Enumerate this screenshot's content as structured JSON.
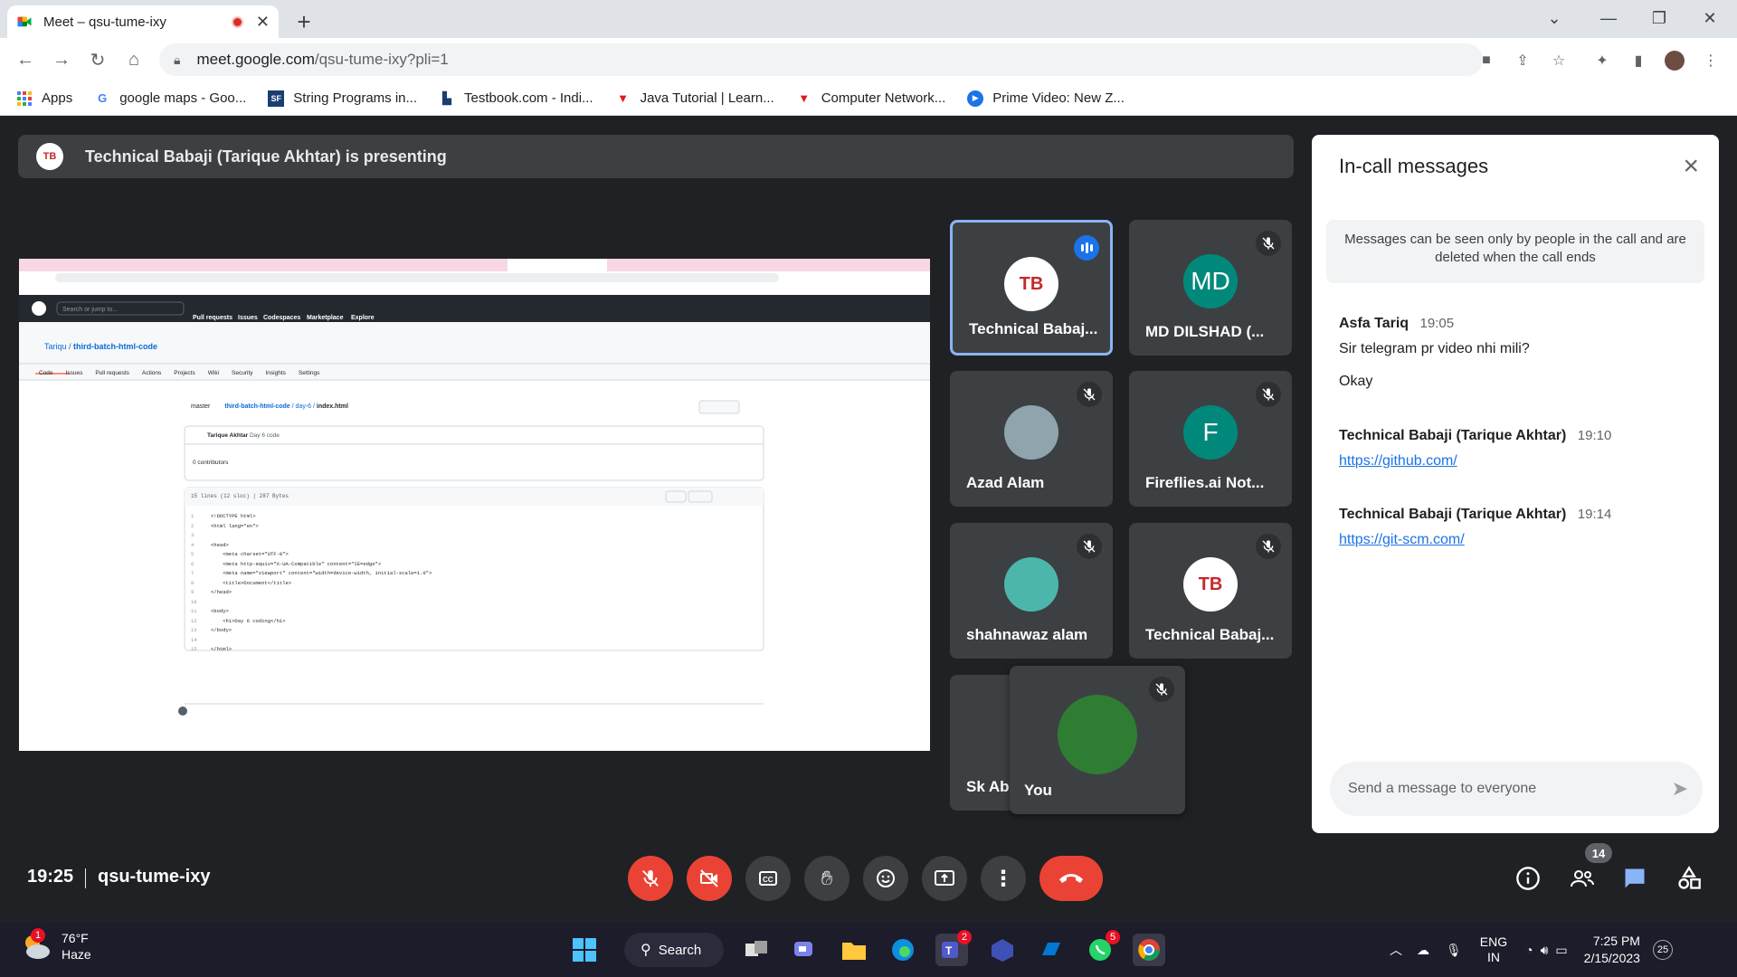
{
  "browser": {
    "tab_title": "Meet – qsu-tume-ixy",
    "url_host": "meet.google.com",
    "url_path": "/qsu-tume-ixy?pli=1"
  },
  "bookmarks": [
    {
      "label": "Apps",
      "icon": "apps-grid-icon"
    },
    {
      "label": "google maps - Goo...",
      "icon": "google-icon"
    },
    {
      "label": "String Programs in...",
      "icon": "sf-icon"
    },
    {
      "label": "Testbook.com - Indi...",
      "icon": "testbook-icon"
    },
    {
      "label": "Java Tutorial | Learn...",
      "icon": "javatpoint-icon"
    },
    {
      "label": "Computer Network...",
      "icon": "javatpoint-icon"
    },
    {
      "label": "Prime Video: New Z...",
      "icon": "prime-video-icon"
    }
  ],
  "presenting": {
    "text": "Technical Babaji (Tarique Akhtar) is presenting"
  },
  "shared_screen": {
    "repo_owner": "Tariqu",
    "repo_name": "third-batch-html-code",
    "branch": "master",
    "file_path_repo": "third-batch-html-code",
    "file_path_dir": "/ day-6 /",
    "file_name": "index.html",
    "commit_author": "Tarique Akhtar",
    "commit_msg": "Day 6 code",
    "contributors": "0 contributors",
    "file_meta": "15 lines (12 sloc)  |  287 Bytes",
    "code_lines": [
      "<!DOCTYPE html>",
      "<html lang=\"en\">",
      "",
      "<head>",
      "    <meta charset=\"UTF-8\">",
      "    <meta http-equiv=\"X-UA-Compatible\" content=\"IE=edge\">",
      "    <meta name=\"viewport\" content=\"width=device-width, initial-scale=1.0\">",
      "    <title>Document</title>",
      "</head>",
      "",
      "<body>",
      "    <h1>Day 6 coding</h1>",
      "</body>",
      "",
      "</html>"
    ],
    "github_nav": [
      "Pull requests",
      "Issues",
      "Codespaces",
      "Marketplace",
      "Explore"
    ],
    "repo_tabs": [
      "Code",
      "Issues",
      "Pull requests",
      "Actions",
      "Projects",
      "Wiki",
      "Security",
      "Insights",
      "Settings"
    ]
  },
  "participants": [
    {
      "name": "Technical Babaj...",
      "avatar_text": "TB",
      "speaking": true,
      "muted": false
    },
    {
      "name": "MD DILSHAD (...",
      "avatar_text": "MD",
      "muted": true
    },
    {
      "name": "Azad Alam",
      "avatar_text": "",
      "muted": true
    },
    {
      "name": "Fireflies.ai Not...",
      "avatar_text": "F",
      "muted": true
    },
    {
      "name": "shahnawaz alam",
      "avatar_text": "",
      "muted": true
    },
    {
      "name": "Technical Babaj...",
      "avatar_text": "TB",
      "muted": true
    },
    {
      "name": "Sk Ab",
      "avatar_text": "",
      "muted": false
    },
    {
      "name": "You",
      "avatar_text": "",
      "muted": true
    }
  ],
  "chat": {
    "title": "In-call messages",
    "notice": "Messages can be seen only by people in the call and are deleted when the call ends",
    "messages": [
      {
        "sender": "Asfa Tariq",
        "time": "19:05",
        "lines": [
          "Sir telegram pr video nhi mili?",
          "Okay"
        ]
      },
      {
        "sender": "Technical Babaji (Tarique Akhtar)",
        "time": "19:10",
        "link": "https://github.com/"
      },
      {
        "sender": "Technical Babaji (Tarique Akhtar)",
        "time": "19:14",
        "link": "https://git-scm.com/"
      }
    ],
    "input_placeholder": "Send a message to everyone"
  },
  "meeting": {
    "time": "19:25",
    "code": "qsu-tume-ixy",
    "people_count": "14"
  },
  "taskbar": {
    "temp": "76°F",
    "weather": "Haze",
    "weather_badge": "1",
    "search_label": "Search",
    "teams_badge": "2",
    "whatsapp_badge": "5",
    "lang": "ENG",
    "region": "IN",
    "time": "7:25 PM",
    "date": "2/15/2023",
    "notif_count": "25"
  },
  "colors": {
    "meet_bg": "#202124",
    "tile_bg": "#3c4043",
    "danger": "#ea4335",
    "accent": "#1a73e8",
    "link": "#1a73e8"
  }
}
